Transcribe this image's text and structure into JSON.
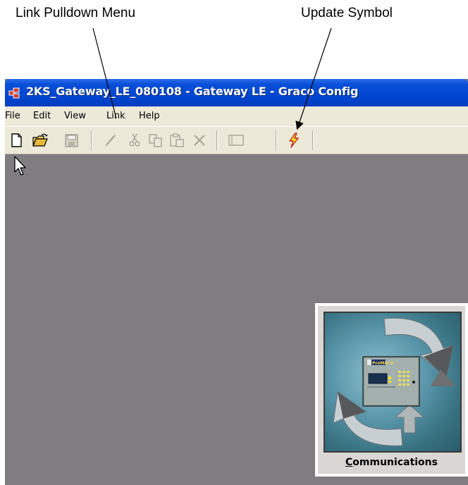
{
  "annotations": {
    "link_menu_callout": "Link Pulldown Menu",
    "update_symbol_callout": "Update Symbol"
  },
  "window": {
    "title": "2KS_Gateway_LE_080108 - Gateway LE - Graco Config",
    "title_color": "#0a4fd8"
  },
  "menu": {
    "file": "File",
    "edit": "Edit",
    "view": "View",
    "link": "Link",
    "help": "Help"
  },
  "toolbar": {
    "buttons": [
      "new-icon",
      "open-icon",
      "save-icon",
      "pencil-icon",
      "cut-icon",
      "copy-icon",
      "paste-icon",
      "delete-icon",
      "window-icon",
      "update-icon"
    ]
  },
  "communications": {
    "label": "Communications",
    "device_badge": "ProMix II"
  }
}
